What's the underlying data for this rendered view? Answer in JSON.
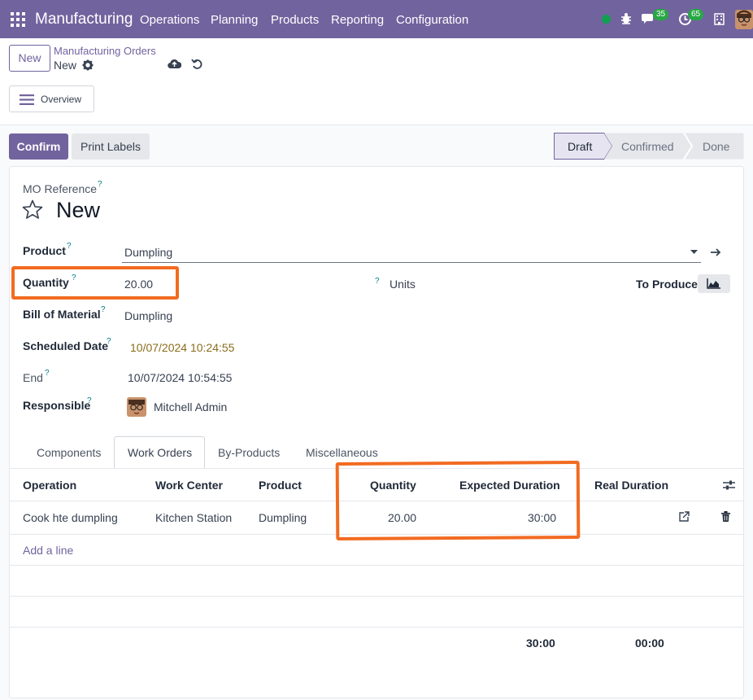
{
  "app": {
    "name": "Manufacturing",
    "menu": [
      "Operations",
      "Planning",
      "Products",
      "Reporting",
      "Configuration"
    ],
    "messages_badge": "35",
    "activities_badge": "65"
  },
  "control": {
    "new_label": "New",
    "breadcrumb_parent": "Manufacturing Orders",
    "breadcrumb_current": "New",
    "overview_label": "Overview"
  },
  "actions": {
    "confirm_label": "Confirm",
    "print_labels_label": "Print Labels"
  },
  "statusbar": {
    "stages": [
      "Draft",
      "Confirmed",
      "Done"
    ],
    "active": "Draft"
  },
  "form": {
    "ref_label": "MO Reference",
    "ref_value": "New",
    "product_label": "Product",
    "product_value": "Dumpling",
    "quantity_label": "Quantity",
    "quantity_value": "20.00",
    "uom_value": "Units",
    "to_produce_label": "To Produce",
    "bom_label": "Bill of Material",
    "bom_value": "Dumpling",
    "scheduled_label": "Scheduled Date",
    "scheduled_value": "10/07/2024 10:24:55",
    "end_label": "End",
    "end_value": "10/07/2024 10:54:55",
    "responsible_label": "Responsible",
    "responsible_value": "Mitchell Admin",
    "help_mark": "?"
  },
  "tabs": [
    "Components",
    "Work Orders",
    "By-Products",
    "Miscellaneous"
  ],
  "workorders": {
    "columns": [
      "Operation",
      "Work Center",
      "Product",
      "Quantity",
      "Expected Duration",
      "Real Duration"
    ],
    "rows": [
      {
        "operation": "Cook hte dumpling",
        "work_center": "Kitchen Station",
        "product": "Dumpling",
        "quantity": "20.00",
        "expected": "30:00"
      }
    ],
    "add_line": "Add a line",
    "total_expected": "30:00",
    "total_real": "00:00"
  },
  "colors": {
    "brand": "#71639e",
    "highlight": "#f26b21",
    "date": "#8a6d1b"
  }
}
